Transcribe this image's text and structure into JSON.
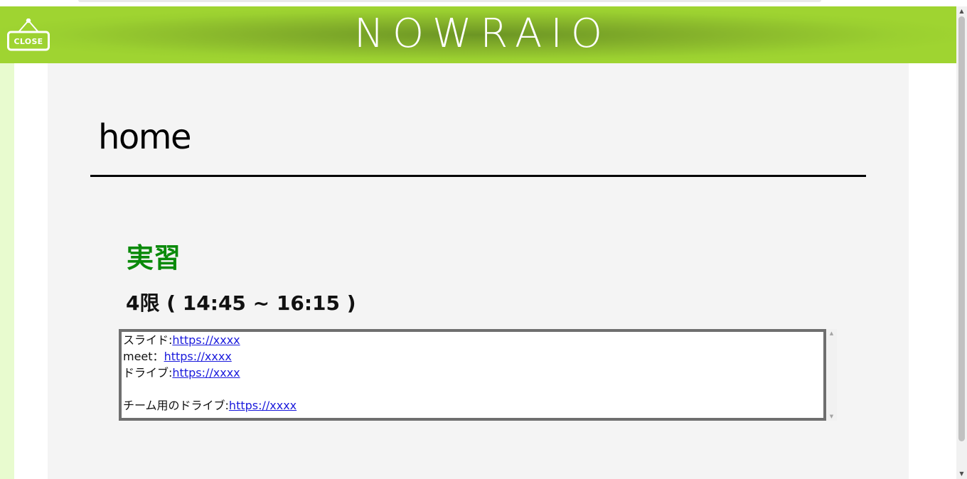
{
  "header": {
    "brand": "NOWRAIO",
    "close_label": "CLOSE",
    "background_colors": [
      "#9fd431",
      "#6c9524"
    ]
  },
  "main": {
    "page_title": "home",
    "subject": "実習",
    "subject_color": "#0a8a0a",
    "period": "4限 ( 14:45 ~ 16:15 )",
    "notes": {
      "lines": [
        {
          "label": "スライド:",
          "link": "https://xxxx"
        },
        {
          "label": "meet：",
          "link": "https://xxxx"
        },
        {
          "label": "ドライブ:",
          "link": "https://xxxx"
        },
        {
          "label": "",
          "link": ""
        },
        {
          "label": "チーム用のドライブ:",
          "link": "https://xxxx"
        }
      ]
    }
  },
  "icons": {
    "close": "hanging-sign-icon",
    "scroll_up": "triangle-up-icon",
    "scroll_down": "triangle-down-icon"
  },
  "colors": {
    "side_stripe": "#e8fbcf",
    "content_bg": "#f4f4f4",
    "link": "#1a1adc"
  }
}
